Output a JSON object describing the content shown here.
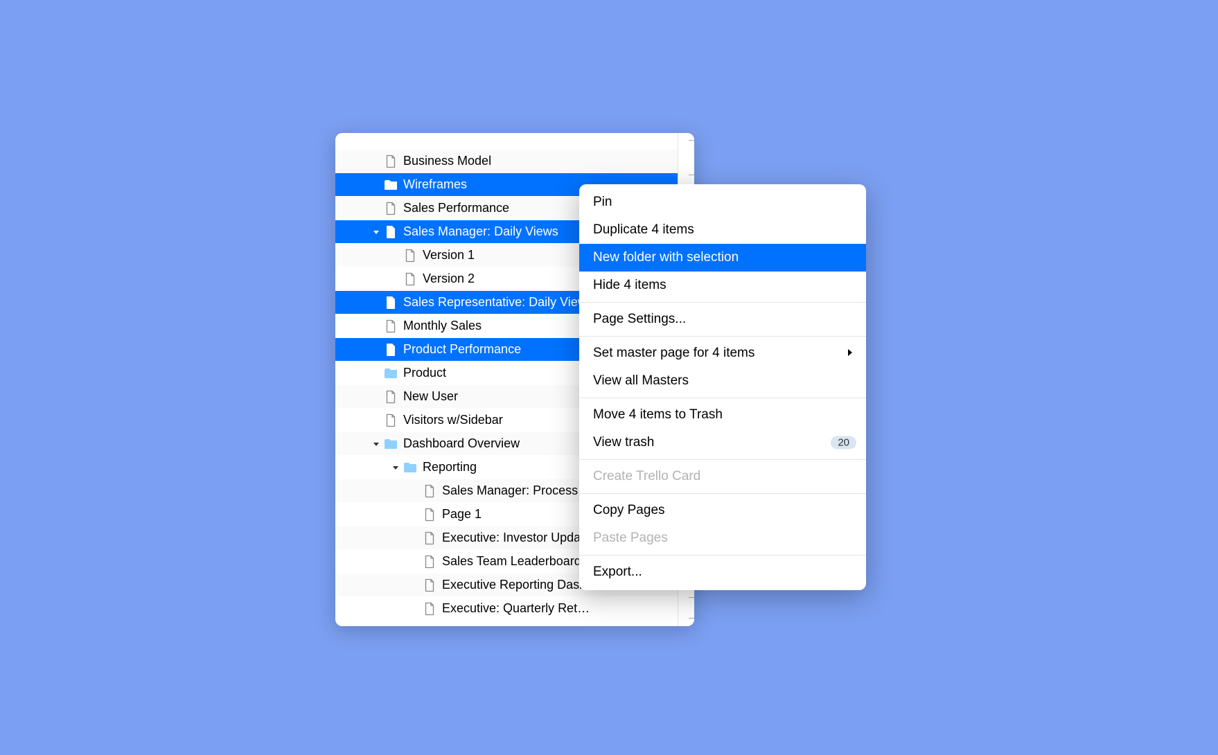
{
  "tree": [
    {
      "label": "Business Model",
      "icon": "page",
      "indent": 1,
      "selected": false,
      "disclosure": null
    },
    {
      "label": "Wireframes",
      "icon": "folder",
      "indent": 1,
      "selected": true,
      "disclosure": null
    },
    {
      "label": "Sales Performance",
      "icon": "page",
      "indent": 1,
      "selected": false,
      "disclosure": null
    },
    {
      "label": "Sales Manager: Daily Views",
      "icon": "page-filled",
      "indent": 1,
      "selected": true,
      "disclosure": "down"
    },
    {
      "label": "Version 1",
      "icon": "page",
      "indent": 2,
      "selected": false,
      "disclosure": null
    },
    {
      "label": "Version 2",
      "icon": "page",
      "indent": 2,
      "selected": false,
      "disclosure": null
    },
    {
      "label": "Sales Representative: Daily Views",
      "icon": "page-filled",
      "indent": 1,
      "selected": true,
      "disclosure": null
    },
    {
      "label": "Monthly Sales",
      "icon": "page",
      "indent": 1,
      "selected": false,
      "disclosure": null
    },
    {
      "label": "Product Performance",
      "icon": "page-filled",
      "indent": 1,
      "selected": true,
      "disclosure": null
    },
    {
      "label": "Product",
      "icon": "folder-light",
      "indent": 1,
      "selected": false,
      "disclosure": null
    },
    {
      "label": "New User",
      "icon": "page",
      "indent": 1,
      "selected": false,
      "disclosure": null
    },
    {
      "label": "Visitors w/Sidebar",
      "icon": "page",
      "indent": 1,
      "selected": false,
      "disclosure": null
    },
    {
      "label": "Dashboard Overview",
      "icon": "folder-light",
      "indent": 1,
      "selected": false,
      "disclosure": "down"
    },
    {
      "label": "Reporting",
      "icon": "folder-light",
      "indent": 2,
      "selected": false,
      "disclosure": "down"
    },
    {
      "label": "Sales Manager: Process",
      "icon": "page",
      "indent": 3,
      "selected": false,
      "disclosure": null
    },
    {
      "label": "Page 1",
      "icon": "page",
      "indent": 3,
      "selected": false,
      "disclosure": null
    },
    {
      "label": "Executive: Investor Update",
      "icon": "page",
      "indent": 3,
      "selected": false,
      "disclosure": null
    },
    {
      "label": "Sales Team Leaderboard",
      "icon": "page",
      "indent": 3,
      "selected": false,
      "disclosure": null
    },
    {
      "label": "Executive Reporting Dashboard",
      "icon": "page",
      "indent": 3,
      "selected": false,
      "disclosure": null
    },
    {
      "label": "Executive: Quarterly Ret…",
      "icon": "page",
      "indent": 3,
      "selected": false,
      "disclosure": null
    }
  ],
  "menu": {
    "items": [
      {
        "label": "Pin",
        "kind": "item"
      },
      {
        "label": "Duplicate 4 items",
        "kind": "item"
      },
      {
        "label": "New folder with selection",
        "kind": "item",
        "highlight": true
      },
      {
        "label": "Hide 4 items",
        "kind": "item"
      },
      {
        "kind": "sep"
      },
      {
        "label": "Page Settings...",
        "kind": "item"
      },
      {
        "kind": "sep"
      },
      {
        "label": "Set master page for 4 items",
        "kind": "item",
        "submenu": true
      },
      {
        "label": "View all Masters",
        "kind": "item"
      },
      {
        "kind": "sep"
      },
      {
        "label": "Move 4 items to Trash",
        "kind": "item"
      },
      {
        "label": "View trash",
        "kind": "item",
        "badge": "20"
      },
      {
        "kind": "sep"
      },
      {
        "label": "Create Trello Card",
        "kind": "item",
        "disabled": true
      },
      {
        "kind": "sep"
      },
      {
        "label": "Copy Pages",
        "kind": "item"
      },
      {
        "label": "Paste Pages",
        "kind": "item",
        "disabled": true
      },
      {
        "kind": "sep"
      },
      {
        "label": "Export...",
        "kind": "item"
      }
    ]
  }
}
